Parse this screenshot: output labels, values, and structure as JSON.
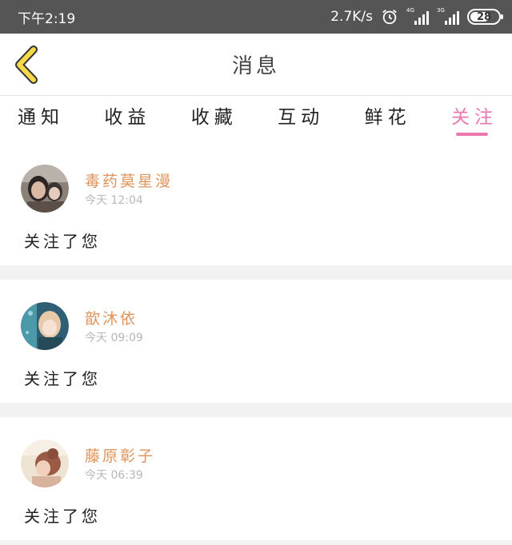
{
  "status_bar": {
    "time": "下午2:19",
    "net_speed": "2.7K/s",
    "sim1_label": "4G",
    "sim2_label": "3G",
    "battery": "28"
  },
  "header": {
    "title": "消息"
  },
  "tabs": [
    {
      "label": "通知",
      "active": false
    },
    {
      "label": "收益",
      "active": false
    },
    {
      "label": "收藏",
      "active": false
    },
    {
      "label": "互动",
      "active": false
    },
    {
      "label": "鲜花",
      "active": false
    },
    {
      "label": "关注",
      "active": true
    }
  ],
  "messages": [
    {
      "username": "毒药莫星漫",
      "time": "今天 12:04",
      "text": "关注了您"
    },
    {
      "username": "歆沐依",
      "time": "今天 09:09",
      "text": "关注了您"
    },
    {
      "username": "藤原彰子",
      "time": "今天 06:39",
      "text": "关注了您"
    }
  ],
  "colors": {
    "accent": "#e879b0",
    "username": "#e0935a",
    "back_arrow": "#f5d94a"
  }
}
